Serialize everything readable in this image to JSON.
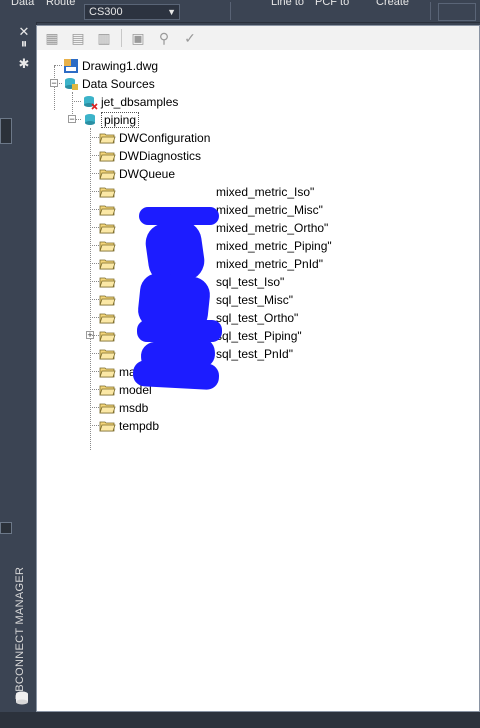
{
  "ribbon": {
    "items": [
      {
        "label": "Data"
      },
      {
        "label": "Route"
      },
      {
        "label": "Line to"
      },
      {
        "label": "PCF to"
      },
      {
        "label": "Create"
      }
    ],
    "combo_value": "CS300"
  },
  "palette": {
    "title": "DBCONNECT MANAGER",
    "icons": [
      "close-icon",
      "pin-icon",
      "settings-icon"
    ]
  },
  "toolbar": {
    "buttons": [
      "view-table-icon",
      "edit-table-icon",
      "link-table-icon",
      "label-icon",
      "link-icon",
      "validate-icon"
    ]
  },
  "tree": {
    "drawing": "Drawing1.dwg",
    "data_sources": "Data Sources",
    "jet": "jet_dbsamples",
    "piping": "piping",
    "tables": [
      "DWConfiguration",
      "DWDiagnostics",
      "DWQueue",
      "mixed_metric_Iso\"",
      "mixed_metric_Misc\"",
      "mixed_metric_Ortho\"",
      "mixed_metric_Piping\"",
      "mixed_metric_PnId\"",
      "sql_test_Iso\"",
      "sql_test_Misc\"",
      "sql_test_Ortho\"",
      "sql_test_Piping\"",
      "sql_test_PnId\"",
      "master",
      "model",
      "msdb",
      "tempdb"
    ]
  },
  "colors": {
    "scribble": "#1c1cff",
    "chrome": "#3b4453"
  }
}
